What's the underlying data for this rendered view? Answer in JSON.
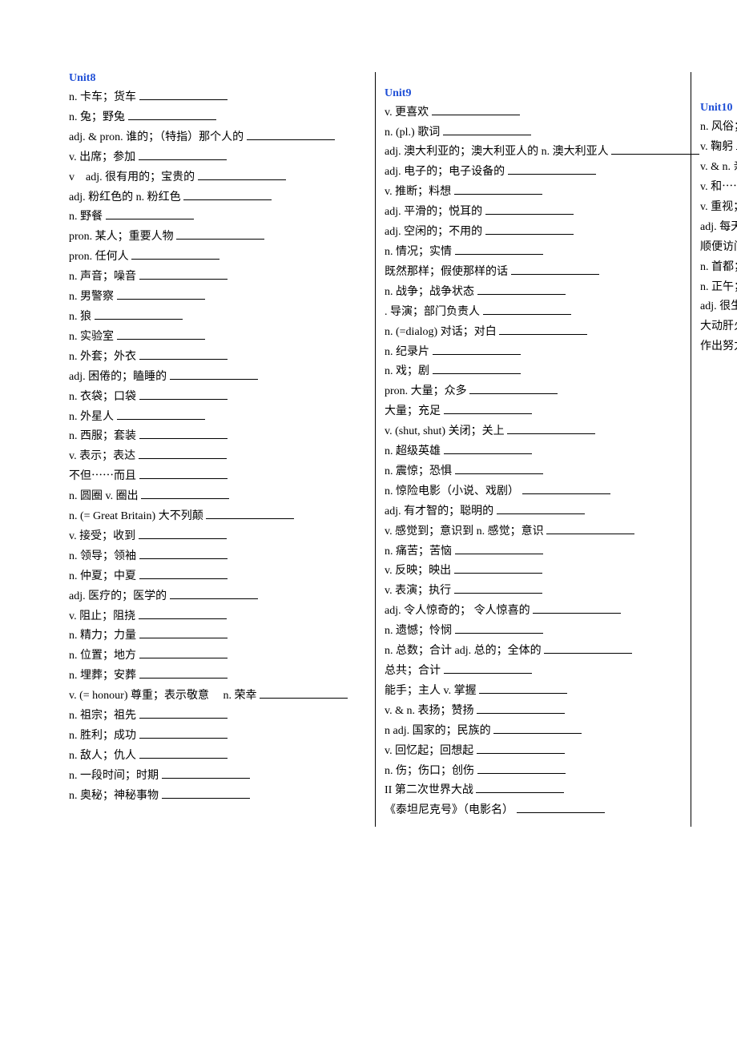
{
  "units": [
    {
      "title": "Unit8",
      "items": [
        {
          "pos": " n.",
          "def": "卡车；货车"
        },
        {
          "pos": "n.",
          "def": "兔；野兔"
        },
        {
          "pos": "adj. & pron.",
          "def": "谁的；（特指）那个人的"
        },
        {
          "pos": "v.",
          "def": "出席；参加"
        },
        {
          "pos": "v　adj.",
          "def": " 很有用的；宝贵的"
        },
        {
          "pos": "adj.",
          "def": "粉红色的 n. 粉红色"
        },
        {
          "pos": "n.",
          "def": "野餐"
        },
        {
          "pos": "pron.",
          "def": "某人；重要人物"
        },
        {
          "pos": "pron.",
          "def": "任何人"
        },
        {
          "pos": "n.",
          "def": "声音；噪音"
        },
        {
          "pos": "n.",
          "def": "男警察"
        },
        {
          "pos": "n.",
          "def": "狼"
        },
        {
          "pos": "n.",
          "def": "实验室"
        },
        {
          "pos": "n.",
          "def": "外套；外衣"
        },
        {
          "pos": "adj.",
          "def": "困倦的；瞌睡的"
        },
        {
          "pos": "n.",
          "def": "衣袋；口袋"
        },
        {
          "pos": "n.",
          "def": "外星人"
        },
        {
          "pos": "n.",
          "def": "西服；套装"
        },
        {
          "pos": "v.",
          "def": "表示；表达"
        },
        {
          "pos": "",
          "def": "不但⋯⋯而且"
        },
        {
          "pos": "n.",
          "def": "圆圈 v. 圈出"
        },
        {
          "pos": "n.",
          "def": "(= Great Britain) 大不列颠"
        },
        {
          "pos": "v.",
          "def": "接受；收到"
        },
        {
          "pos": "n.",
          "def": "领导；领袖"
        },
        {
          "pos": "n.",
          "def": "仲夏；中夏"
        },
        {
          "pos": "adj.",
          "def": "医疗的；医学的"
        },
        {
          "pos": " v.",
          "def": "阻止；阻挠"
        },
        {
          "pos": "n.",
          "def": "精力；力量"
        },
        {
          "pos": "n.",
          "def": "位置；地方"
        },
        {
          "pos": "n.",
          "def": "埋葬；安葬"
        },
        {
          "pos": "v.",
          "def": "(= honour) 尊重；表示敬意　 n. 荣幸"
        },
        {
          "pos": "n.",
          "def": "祖宗；祖先"
        },
        {
          "pos": "n.",
          "def": "胜利；成功"
        },
        {
          "pos": "n.",
          "def": "敌人；仇人"
        },
        {
          "pos": "n.",
          "def": "一段时间；时期"
        },
        {
          "pos": "n.",
          "def": "奥秘；神秘事物"
        }
      ]
    },
    {
      "title": "Unit9",
      "items": [
        {
          "pos": "v.",
          "def": "更喜欢"
        },
        {
          "pos": "n. (pl.)",
          "def": "歌词"
        },
        {
          "pos": "adj.",
          "def": " 澳大利亚的；澳大利亚人的 n. 澳大利亚人"
        },
        {
          "pos": "adj.",
          "def": "电子的；电子设备的"
        },
        {
          "pos": "v.",
          "def": "推断；料想"
        },
        {
          "pos": "adj.",
          "def": "平滑的；悦耳的"
        },
        {
          "pos": "adj.",
          "def": "空闲的；不用的"
        },
        {
          "pos": "n.",
          "def": "情况；实情"
        },
        {
          "pos": "",
          "def": "既然那样；假使那样的话"
        },
        {
          "pos": "n.",
          "def": "战争；战争状态"
        },
        {
          "pos": ".",
          "def": "导演；部门负责人"
        },
        {
          "pos": "n.",
          "def": "(=dialog) 对话；对白"
        },
        {
          "pos": "n.",
          "def": "纪录片"
        },
        {
          "pos": "n.",
          "def": "戏；剧"
        },
        {
          "pos": " pron.",
          "def": "大量；众多"
        },
        {
          "pos": "",
          "def": "大量；充足"
        },
        {
          "pos": "v.",
          "def": "(shut, shut) 关闭；关上"
        },
        {
          "pos": "n.",
          "def": "超级英雄"
        },
        {
          "pos": "n.",
          "def": "震惊；恐惧"
        },
        {
          "pos": "n.",
          "def": "惊险电影（小说、戏剧）"
        },
        {
          "pos": "adj.",
          "def": "有才智的；聪明的"
        },
        {
          "pos": "v.",
          "def": "感觉到；意识到 n. 感觉；意识"
        },
        {
          "pos": "n.",
          "def": "痛苦；苦恼"
        },
        {
          "pos": "v.",
          "def": "反映；映出"
        },
        {
          "pos": "v.",
          "def": "表演；执行"
        },
        {
          "pos": "adj.",
          "def": "令人惊奇的； 令人惊喜的"
        },
        {
          "pos": "n.",
          "def": "遗憾；怜悯"
        },
        {
          "pos": "n.",
          "def": "总数；合计 adj. 总的；全体的"
        },
        {
          "pos": "",
          "def": "总共；合计"
        },
        {
          "pos": "",
          "def": "能手；主人 v. 掌握"
        },
        {
          "pos": "v. & n.",
          "def": "表扬；赞扬"
        },
        {
          "pos": "n adj.",
          "def": "国家的；民族的"
        },
        {
          "pos": "v.",
          "def": "回忆起；回想起"
        },
        {
          "pos": "n.",
          "def": "伤；伤口；创伤"
        },
        {
          "pos": "II",
          "def": "第二次世界大战"
        },
        {
          "pos": "",
          "def": "《泰坦尼克号》（电影名）"
        }
      ]
    },
    {
      "title": "Unit10",
      "items": [
        {
          "pos": "n.",
          "def": "风俗；习俗"
        },
        {
          "pos": "v.",
          "def": "鞠躬"
        },
        {
          "pos": "v. & n.",
          "def": "亲吻；接吻"
        },
        {
          "pos": "v.",
          "def": "和⋯⋯打招呼；迎接"
        },
        {
          "pos": "v.",
          "def": "重视；珍视 n. 价值"
        },
        {
          "pos": "adj.",
          "def": "每天的；日常的"
        },
        {
          "pos": "",
          "def": "顺便访问；随便进入"
        },
        {
          "pos": "n.",
          "def": "首都；国都"
        },
        {
          "pos": "n.",
          "def": "正午；中午"
        },
        {
          "pos": "adj.",
          "def": "很生气；疯的"
        },
        {
          "pos": "",
          "def": "大动肝火；气愤"
        },
        {
          "pos": "",
          "def": "作出努力"
        }
      ]
    }
  ]
}
